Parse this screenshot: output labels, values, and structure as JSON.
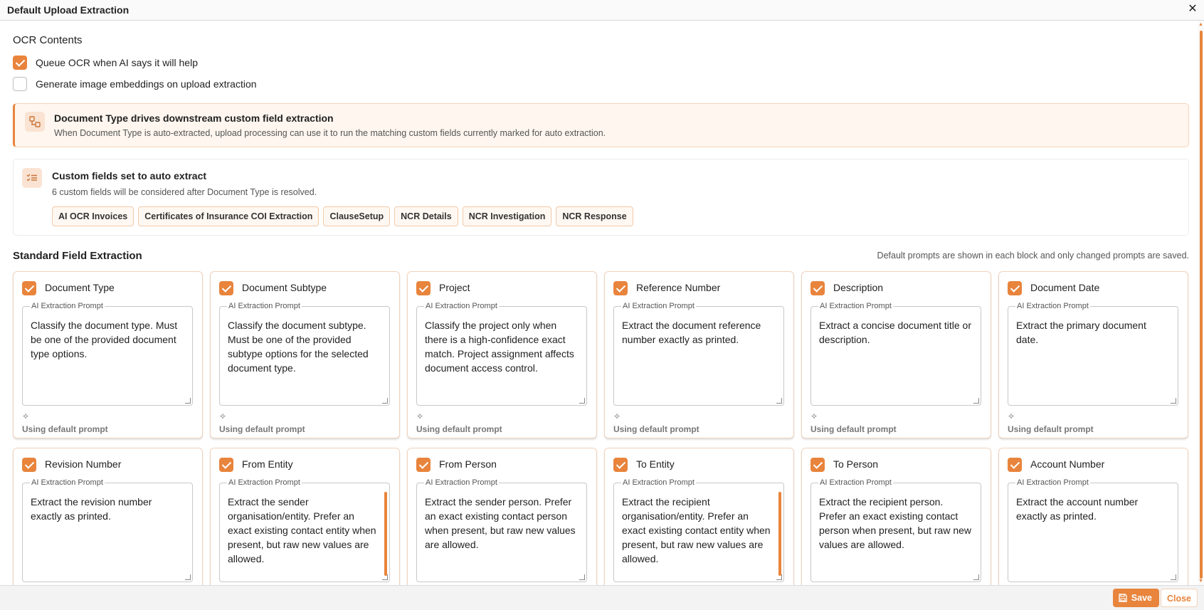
{
  "window": {
    "title": "Default Upload Extraction",
    "close_glyph": "✕"
  },
  "ocr": {
    "title": "OCR Contents",
    "options": [
      {
        "label": "Queue OCR when AI says it will help",
        "checked": true
      },
      {
        "label": "Generate image embeddings on upload extraction",
        "checked": false
      }
    ]
  },
  "banner": {
    "icon": "flow-icon",
    "heading": "Document Type drives downstream custom field extraction",
    "text": "When Document Type is auto-extracted, upload processing can use it to run the matching custom fields currently marked for auto extraction."
  },
  "custom_fields": {
    "icon": "checklist-icon",
    "heading": "Custom fields set to auto extract",
    "text": "6 custom fields will be considered after Document Type is resolved.",
    "chips": [
      "AI OCR Invoices",
      "Certificates of Insurance COI Extraction",
      "ClauseSetup",
      "NCR Details",
      "NCR Investigation",
      "NCR Response"
    ]
  },
  "standard": {
    "title": "Standard Field Extraction",
    "note": "Default prompts are shown in each block and only changed prompts are saved.",
    "prompt_label": "AI Extraction Prompt",
    "default_text": "Using default prompt",
    "cards": [
      {
        "name": "Document Type",
        "prompt": "Classify the document type. Must be one of the provided document type options."
      },
      {
        "name": "Document Subtype",
        "prompt": "Classify the document subtype. Must be one of the provided subtype options for the selected document type."
      },
      {
        "name": "Project",
        "prompt": "Classify the project only when there is a high-confidence exact match. Project assignment affects document access control."
      },
      {
        "name": "Reference Number",
        "prompt": "Extract the document reference number exactly as printed."
      },
      {
        "name": "Description",
        "prompt": "Extract a concise document title or description."
      },
      {
        "name": "Document Date",
        "prompt": "Extract the primary document date."
      },
      {
        "name": "Revision Number",
        "prompt": "Extract the revision number exactly as printed."
      },
      {
        "name": "From Entity",
        "prompt": "Extract the sender organisation/entity. Prefer an exact existing contact entity when present, but raw new values are allowed."
      },
      {
        "name": "From Person",
        "prompt": "Extract the sender person. Prefer an exact existing contact person when present, but raw new values are allowed."
      },
      {
        "name": "To Entity",
        "prompt": "Extract the recipient organisation/entity. Prefer an exact existing contact entity when present, but raw new values are allowed."
      },
      {
        "name": "To Person",
        "prompt": "Extract the recipient person. Prefer an exact existing contact person when present, but raw new values are allowed."
      },
      {
        "name": "Account Number",
        "prompt": "Extract the account number exactly as printed."
      }
    ]
  },
  "footer": {
    "save_label": "Save",
    "close_label": "Close"
  },
  "colors": {
    "accent": "#e8843c",
    "accent_soft": "#fef6ef"
  }
}
